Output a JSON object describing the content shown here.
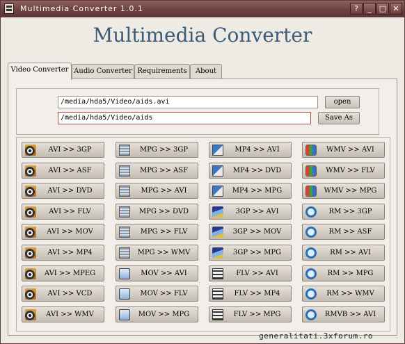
{
  "window": {
    "title": "Multimedia Converter 1.0.1",
    "controls": {
      "help": "?",
      "minimize": "_",
      "maximize": "□",
      "close": "✕"
    }
  },
  "heading": "Multimedia Converter",
  "tabs": [
    {
      "label": "Video Converter",
      "active": true
    },
    {
      "label": "Audio Converter",
      "active": false
    },
    {
      "label": "Requirements",
      "active": false
    },
    {
      "label": "About",
      "active": false
    }
  ],
  "input_path": "/media/hda5/Video/aids.avi",
  "output_path": "/media/hda5/Video/aids",
  "open_label": "open",
  "save_as_label": "Save As",
  "converters": [
    {
      "label": "AVI >> 3GP",
      "icon": "avi-icon",
      "iconclass": "avi"
    },
    {
      "label": "MPG >> 3GP",
      "icon": "mpg-icon",
      "iconclass": "mpg"
    },
    {
      "label": "MP4 >> AVI",
      "icon": "mp4-icon",
      "iconclass": "mp4"
    },
    {
      "label": "WMV >> AVI",
      "icon": "wmv-icon",
      "iconclass": "wmv"
    },
    {
      "label": "AVI >> ASF",
      "icon": "avi-icon",
      "iconclass": "avi"
    },
    {
      "label": "MPG >> ASF",
      "icon": "mpg-icon",
      "iconclass": "mpg"
    },
    {
      "label": "MP4 >> DVD",
      "icon": "mp4-icon",
      "iconclass": "mp4"
    },
    {
      "label": "WMV >> FLV",
      "icon": "wmv-icon",
      "iconclass": "wmv"
    },
    {
      "label": "AVI >> DVD",
      "icon": "avi-icon",
      "iconclass": "avi"
    },
    {
      "label": "MPG >> AVI",
      "icon": "mpg-icon",
      "iconclass": "mpg"
    },
    {
      "label": "MP4 >> MPG",
      "icon": "mp4-icon",
      "iconclass": "mp4"
    },
    {
      "label": "WMV >> MPG",
      "icon": "wmv-icon",
      "iconclass": "wmv"
    },
    {
      "label": "AVI >> FLV",
      "icon": "avi-icon",
      "iconclass": "avi"
    },
    {
      "label": "MPG >> DVD",
      "icon": "mpg-icon",
      "iconclass": "mpg"
    },
    {
      "label": "3GP >> AVI",
      "icon": "3gp-icon",
      "iconclass": "3gp"
    },
    {
      "label": "RM >> 3GP",
      "icon": "rm-icon",
      "iconclass": "rm"
    },
    {
      "label": "AVI >> MOV",
      "icon": "avi-icon",
      "iconclass": "avi"
    },
    {
      "label": "MPG >> FLV",
      "icon": "mpg-icon",
      "iconclass": "mpg"
    },
    {
      "label": "3GP >> MOV",
      "icon": "3gp-icon",
      "iconclass": "3gp"
    },
    {
      "label": "RM >> ASF",
      "icon": "rm-icon",
      "iconclass": "rm"
    },
    {
      "label": "AVI >> MP4",
      "icon": "avi-icon",
      "iconclass": "avi"
    },
    {
      "label": "MPG >> WMV",
      "icon": "mpg-icon",
      "iconclass": "mpg"
    },
    {
      "label": "3GP >> MPG",
      "icon": "3gp-icon",
      "iconclass": "3gp"
    },
    {
      "label": "RM >> AVI",
      "icon": "rm-icon",
      "iconclass": "rm"
    },
    {
      "label": "AVI >> MPEG",
      "icon": "avi-icon",
      "iconclass": "avi"
    },
    {
      "label": "MOV >> AVI",
      "icon": "mov-icon",
      "iconclass": "mov"
    },
    {
      "label": "FLV >> AVI",
      "icon": "flv-icon",
      "iconclass": "flv"
    },
    {
      "label": "RM >> MPG",
      "icon": "rm-icon",
      "iconclass": "rm"
    },
    {
      "label": "AVI >> VCD",
      "icon": "avi-icon",
      "iconclass": "avi"
    },
    {
      "label": "MOV >> FLV",
      "icon": "mov-icon",
      "iconclass": "mov"
    },
    {
      "label": "FLV >> MP4",
      "icon": "flv-icon",
      "iconclass": "flv"
    },
    {
      "label": "RM >> WMV",
      "icon": "rm-icon",
      "iconclass": "rm"
    },
    {
      "label": "AVI >> WMV",
      "icon": "avi-icon",
      "iconclass": "avi"
    },
    {
      "label": "MOV >> MPG",
      "icon": "mov-icon",
      "iconclass": "mov"
    },
    {
      "label": "FLV >> MPG",
      "icon": "flv-icon",
      "iconclass": "flv"
    },
    {
      "label": "RMVB >> AVI",
      "icon": "rm-icon",
      "iconclass": "rm"
    }
  ],
  "watermark": "generalitati.3xforum.ro"
}
